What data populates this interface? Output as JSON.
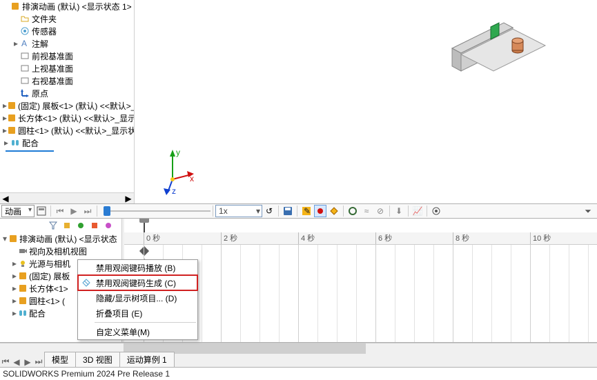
{
  "feature_tree": [
    {
      "indent": 0,
      "expand": "",
      "icon": "cube-yellow",
      "label": "排演动画 (默认) <显示状态 1>",
      "cut": true
    },
    {
      "indent": 1,
      "expand": "",
      "icon": "folder",
      "label": "文件夹"
    },
    {
      "indent": 1,
      "expand": "",
      "icon": "sensor",
      "label": "传感器"
    },
    {
      "indent": 1,
      "expand": "▸",
      "icon": "annot",
      "label": "注解"
    },
    {
      "indent": 1,
      "expand": "",
      "icon": "plane",
      "label": "前视基准面"
    },
    {
      "indent": 1,
      "expand": "",
      "icon": "plane",
      "label": "上视基准面"
    },
    {
      "indent": 1,
      "expand": "",
      "icon": "plane",
      "label": "右视基准面"
    },
    {
      "indent": 1,
      "expand": "",
      "icon": "origin",
      "label": "原点"
    },
    {
      "indent": 0,
      "expand": "▸",
      "icon": "part",
      "label": "(固定) 展板<1> (默认) <<默认>_"
    },
    {
      "indent": 0,
      "expand": "▸",
      "icon": "part",
      "label": "长方体<1> (默认) <<默认>_显示"
    },
    {
      "indent": 0,
      "expand": "▸",
      "icon": "part",
      "label": "圆柱<1> (默认) <<默认>_显示状"
    },
    {
      "indent": 0,
      "expand": "▸",
      "icon": "mate",
      "label": "配合"
    }
  ],
  "anim_toolbar": {
    "dropdown": "动画",
    "time_value": "1x"
  },
  "timeline": {
    "ticks": [
      "0 秒",
      "2 秒",
      "4 秒",
      "6 秒",
      "8 秒",
      "10 秒"
    ]
  },
  "anim_tree": [
    {
      "indent": 0,
      "expand": "▾",
      "icon": "cube-yellow",
      "label": "排演动画 (默认) <显示状态"
    },
    {
      "indent": 1,
      "expand": "",
      "icon": "camera",
      "label": "视向及相机视图"
    },
    {
      "indent": 1,
      "expand": "▸",
      "icon": "light",
      "label": "光源与相机"
    },
    {
      "indent": 1,
      "expand": "▸",
      "icon": "part",
      "label": "(固定) 展板"
    },
    {
      "indent": 1,
      "expand": "▸",
      "icon": "part",
      "label": "长方体<1>"
    },
    {
      "indent": 1,
      "expand": "▸",
      "icon": "part",
      "label": "圆柱<1> ("
    },
    {
      "indent": 1,
      "expand": "▸",
      "icon": "mate",
      "label": "配合"
    }
  ],
  "context_menu": {
    "items": [
      {
        "icon": "",
        "label": "禁用观阅键码播放 (B)",
        "hl": false
      },
      {
        "icon": "key",
        "label": "禁用观阅键码生成 (C)",
        "hl": true
      },
      {
        "icon": "",
        "label": "隐藏/显示树项目... (D)",
        "hl": false
      },
      {
        "icon": "",
        "label": "折叠项目 (E)",
        "hl": false
      },
      {
        "icon": "",
        "label": "自定义菜单(M)",
        "hl": false
      }
    ]
  },
  "tabs": [
    "模型",
    "3D 视图",
    "运动算例 1"
  ],
  "status": "SOLIDWORKS Premium 2024 Pre Release 1",
  "triad_labels": {
    "x": "x",
    "y": "y",
    "z": "z"
  }
}
